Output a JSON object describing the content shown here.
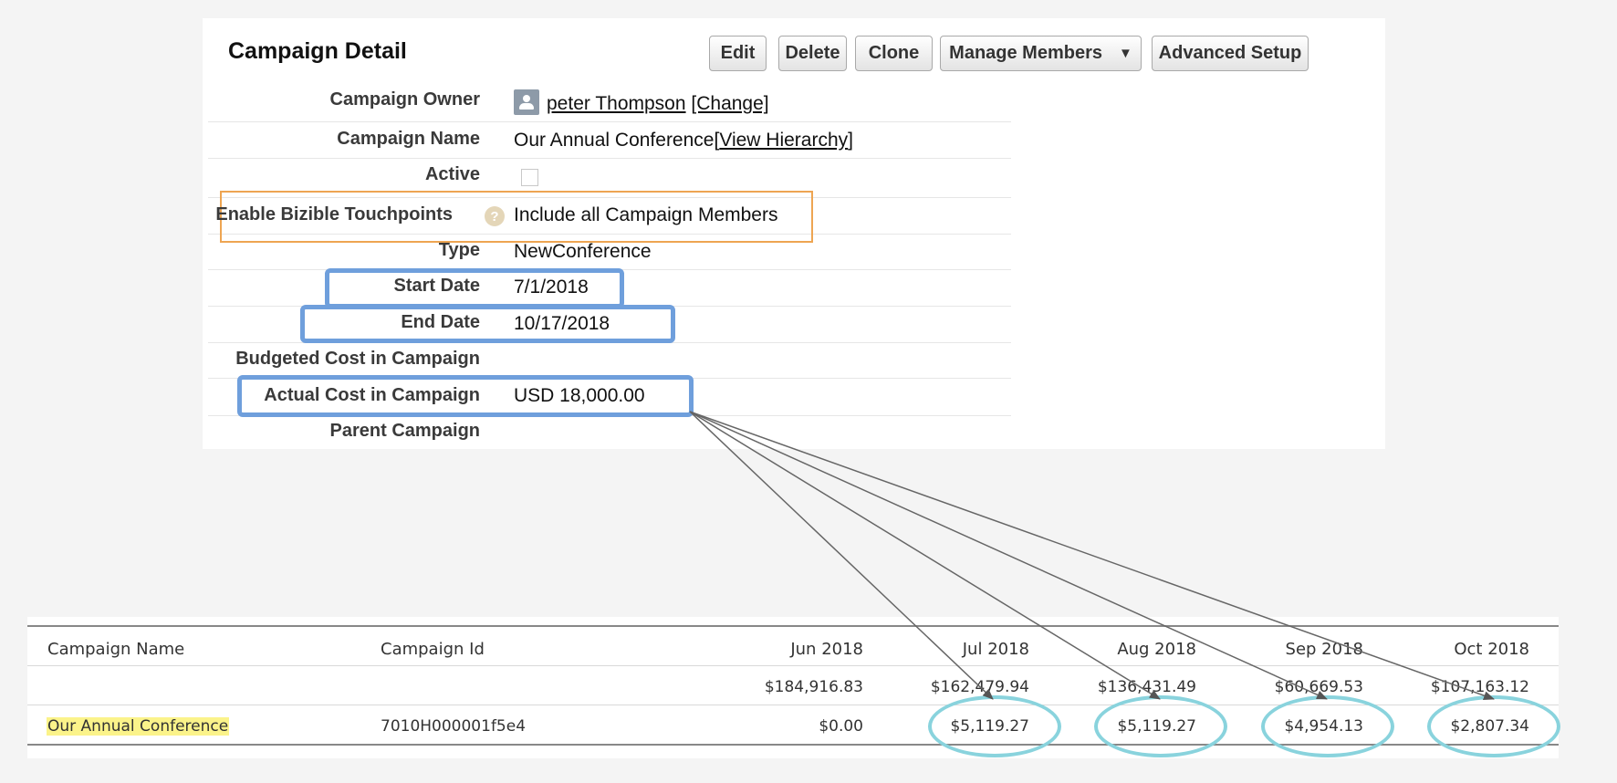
{
  "detail": {
    "title": "Campaign Detail",
    "buttons": {
      "edit": "Edit",
      "delete": "Delete",
      "clone": "Clone",
      "manage_members": "Manage Members",
      "advanced_setup": "Advanced Setup"
    },
    "fields": {
      "owner_label": "Campaign Owner",
      "owner_name": "peter Thompson",
      "owner_change": "[Change]",
      "name_label": "Campaign Name",
      "name_value": "Our Annual Conference",
      "name_hierarchy": "View Hierarchy",
      "active_label": "Active",
      "bizible_label": "Enable Bizible Touchpoints",
      "bizible_value": "Include all Campaign Members",
      "type_label": "Type",
      "type_value": "NewConference",
      "start_label": "Start Date",
      "start_value": "7/1/2018",
      "end_label": "End Date",
      "end_value": "10/17/2018",
      "budget_label": "Budgeted Cost in Campaign",
      "actual_label": "Actual Cost in Campaign",
      "actual_value": "USD 18,000.00",
      "parent_label": "Parent Campaign"
    }
  },
  "report": {
    "headers": {
      "name": "Campaign Name",
      "id": "Campaign Id",
      "jun": "Jun 2018",
      "jul": "Jul 2018",
      "aug": "Aug 2018",
      "sep": "Sep 2018",
      "oct": "Oct 2018"
    },
    "totals": {
      "jun": "$184,916.83",
      "jul": "$162,479.94",
      "aug": "$136,431.49",
      "sep": "$60,669.53",
      "oct": "$107,163.12"
    },
    "row": {
      "name": "Our Annual Conference",
      "id": "7010H000001f5e4",
      "jun": "$0.00",
      "jul": "$5,119.27",
      "aug": "$5,119.27",
      "sep": "$4,954.13",
      "oct": "$2,807.34"
    }
  },
  "colors": {
    "outline_orange": "#eea552",
    "outline_blue": "#6f9fdc",
    "circle_teal": "#89d3dd",
    "highlight_yellow": "#fbf38a"
  }
}
